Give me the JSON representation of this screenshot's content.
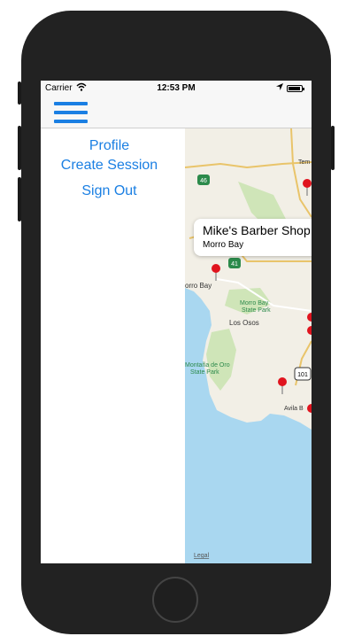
{
  "status_bar": {
    "carrier": "Carrier",
    "time": "12:53 PM",
    "battery_level": 0.9
  },
  "navbar": {
    "menu_icon": "hamburger-icon"
  },
  "menu": {
    "items": [
      {
        "label": "Profile"
      },
      {
        "label": "Create Session"
      },
      {
        "label": "Sign Out"
      }
    ]
  },
  "map": {
    "callout": {
      "title": "Mike's Barber Shop",
      "subtitle": "Morro Bay"
    },
    "places": {
      "morro_bay": "orro Bay",
      "los_osos": "Los Osos",
      "state_park_1": "Morro Bay",
      "state_park_1b": "State Park",
      "state_park_2": "Montaña de Oro",
      "state_park_2b": "State Park",
      "avila": "Avila B",
      "templeton": "Tem",
      "route_46": "46",
      "route_41": "41",
      "route_101": "101",
      "legal": "Legal"
    },
    "colors": {
      "water": "#a9d7f0",
      "land": "#f2efe6",
      "park": "#cfe5b8",
      "pin": "#e0141e"
    }
  }
}
